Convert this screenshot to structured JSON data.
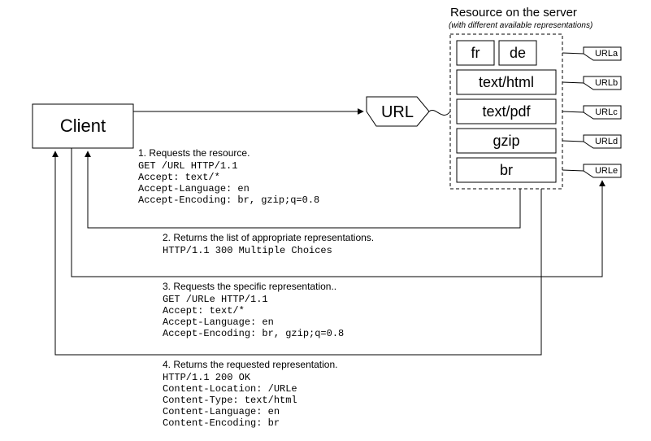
{
  "title": "Resource on the server",
  "subtitle": "(with different available representations)",
  "client": {
    "label": "Client"
  },
  "url": {
    "label": "URL"
  },
  "representations": {
    "row1": {
      "a": "fr",
      "b": "de",
      "tag": "URLa"
    },
    "row2": {
      "a": "text/html",
      "tag": "URLb"
    },
    "row3": {
      "a": "text/pdf",
      "tag": "URLc"
    },
    "row4": {
      "a": "gzip",
      "tag": "URLd"
    },
    "row5": {
      "a": "br",
      "tag": "URLe"
    }
  },
  "steps": {
    "s1": {
      "heading": "1. Requests the resource.",
      "l1": "GET /URL HTTP/1.1",
      "l2": "Accept: text/*",
      "l3": "Accept-Language: en",
      "l4": "Accept-Encoding: br, gzip;q=0.8"
    },
    "s2": {
      "heading": "2. Returns the list of  appropriate representations.",
      "l1": "HTTP/1.1 300 Multiple Choices"
    },
    "s3": {
      "heading": "3. Requests the specific representation..",
      "l1": "GET /URLe HTTP/1.1",
      "l2": "Accept: text/*",
      "l3": "Accept-Language: en",
      "l4": "Accept-Encoding: br, gzip;q=0.8"
    },
    "s4": {
      "heading": "4. Returns the requested representation.",
      "l1": "HTTP/1.1 200 OK",
      "l2": "Content-Location: /URLe",
      "l3": "Content-Type: text/html",
      "l4": "Content-Language: en",
      "l5": "Content-Encoding: br"
    }
  }
}
